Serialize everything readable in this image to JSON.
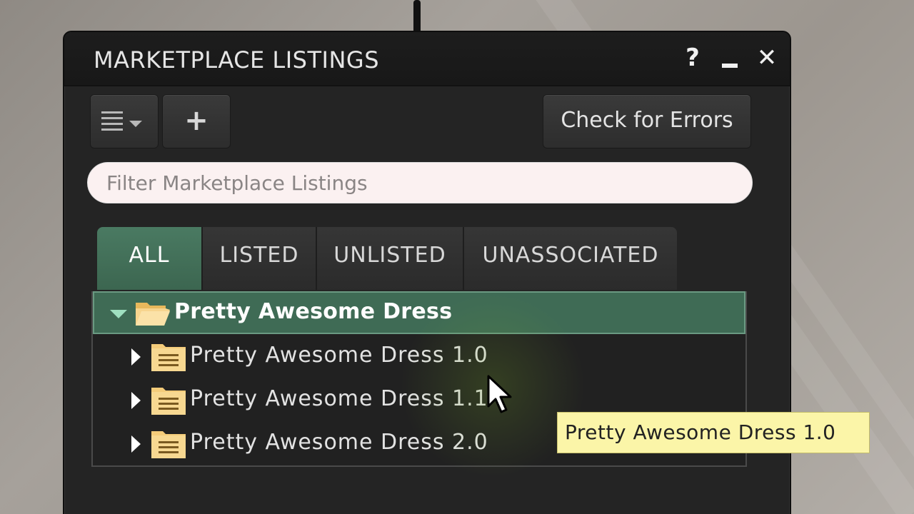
{
  "window": {
    "title": "MARKETPLACE LISTINGS",
    "help_glyph": "?",
    "close_glyph": "✕"
  },
  "toolbar": {
    "add_glyph": "+",
    "check_errors_label": "Check for Errors"
  },
  "filter": {
    "placeholder": "Filter Marketplace Listings",
    "value": ""
  },
  "tabs": [
    {
      "label": "ALL",
      "active": true
    },
    {
      "label": "LISTED",
      "active": false
    },
    {
      "label": "UNLISTED",
      "active": false
    },
    {
      "label": "UNASSOCIATED",
      "active": false
    }
  ],
  "tree": {
    "root": {
      "label": "Pretty Awesome Dress",
      "expanded": true,
      "selected": true
    },
    "children": [
      {
        "label": "Pretty Awesome Dress 1.0"
      },
      {
        "label": "Pretty Awesome Dress 1.1"
      },
      {
        "label": "Pretty Awesome Dress 2.0"
      }
    ]
  },
  "tooltip": {
    "text": "Pretty Awesome Dress 1.0"
  },
  "colors": {
    "accent_green": "#3f6b55",
    "tooltip_bg": "#fbf5a8",
    "folder_yellow": "#f4cc7a"
  },
  "icons": {
    "menu": "hamburger-menu-icon",
    "add": "plus-icon",
    "help": "question-icon",
    "minimize": "minimize-icon",
    "close": "close-icon",
    "folder_open": "open-folder-icon",
    "folder_listing": "listing-folder-icon"
  }
}
